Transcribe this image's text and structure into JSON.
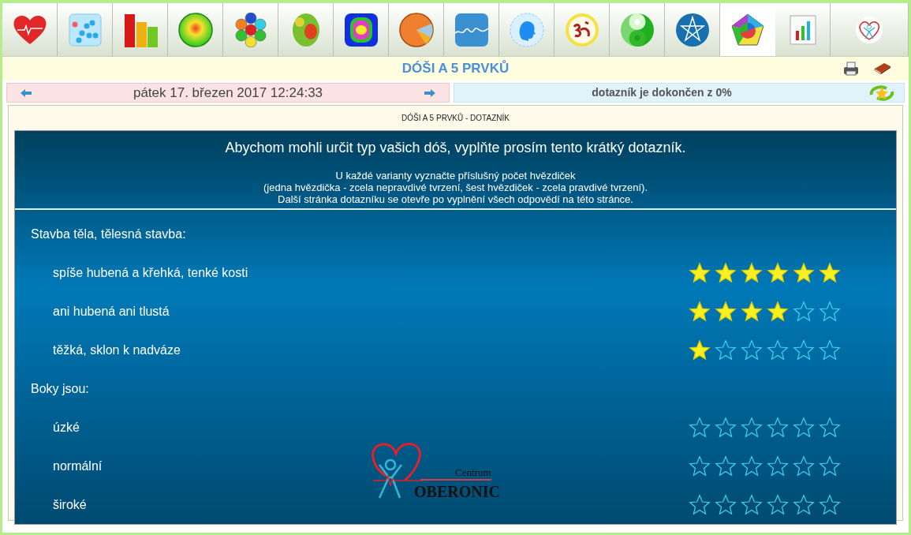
{
  "tabs": [
    {
      "selected": false
    },
    {
      "selected": false
    },
    {
      "selected": false
    },
    {
      "selected": false
    },
    {
      "selected": false
    },
    {
      "selected": false
    },
    {
      "selected": false
    },
    {
      "selected": false
    },
    {
      "selected": false
    },
    {
      "selected": false
    },
    {
      "selected": false
    },
    {
      "selected": false
    },
    {
      "selected": false
    },
    {
      "selected": true
    },
    {
      "selected": false
    },
    {
      "selected": false
    }
  ],
  "title": "DÓŠI A 5 PRVKŮ",
  "date": "pátek 17. březen 2017 12:24:33",
  "progress": "dotazník je dokončen z 0%",
  "panel_title": "DÓŠI A 5 PRVKŮ - DOTAZNÍK",
  "intro": "Abychom mohli určit typ vašich dóš, vyplňte prosím tento krátký dotazník.",
  "instructions": [
    "U každé varianty vyznačte příslušný počet hvězdiček",
    "(jedna hvězdička - zcela nepravdivé tvrzení, šest hvězdiček - zcela pravdivé tvrzení).",
    "Další stránka dotazníku se otevře po vyplnění všech odpovědí na této stránce."
  ],
  "questions": [
    {
      "kind": "heading",
      "label": "Stavba těla, tělesná stavba:"
    },
    {
      "kind": "option",
      "label": "spíše hubená a křehká, tenké kosti",
      "stars": 6
    },
    {
      "kind": "option",
      "label": "ani hubená ani tlustá",
      "stars": 4
    },
    {
      "kind": "option",
      "label": "těžká, sklon k nadváze",
      "stars": 1
    },
    {
      "kind": "heading",
      "label": "Boky jsou:"
    },
    {
      "kind": "option",
      "label": "úzké",
      "stars": 0
    },
    {
      "kind": "option",
      "label": "normální",
      "stars": 0
    },
    {
      "kind": "option",
      "label": "široké",
      "stars": 0
    }
  ],
  "logo": {
    "small": "Centrum",
    "big": "OBERONIC"
  }
}
